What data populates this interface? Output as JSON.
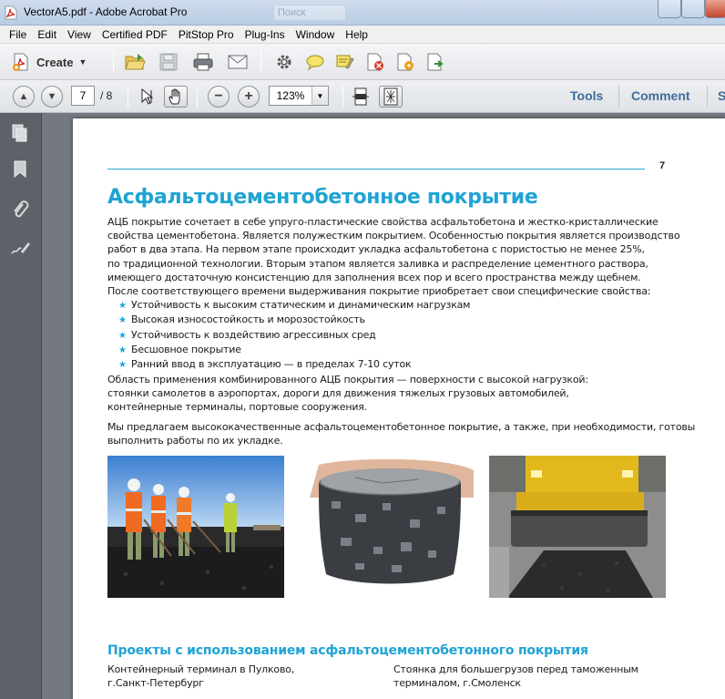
{
  "window": {
    "title": "VectorA5.pdf - Adobe Acrobat Pro",
    "search_placeholder": "Поиск"
  },
  "menu": [
    "File",
    "Edit",
    "View",
    "Certified PDF",
    "PitStop Pro",
    "Plug-Ins",
    "Window",
    "Help"
  ],
  "toolbar": {
    "create_label": "Create"
  },
  "navigation": {
    "current_page": "7",
    "total_pages": "/ 8",
    "zoom": "123%"
  },
  "panes": {
    "tools": "Tools",
    "comment": "Comment",
    "share": "S"
  },
  "document": {
    "page_number": "7",
    "title": "Асфальтоцементобетонное покрытие",
    "intro": [
      "АЦБ покрытие сочетает в себе упруго-пластические свойства асфальтобетона и жестко-кристаллические",
      "свойства цементобетона. Является полужестким покрытием. Особенностью покрытия является производство",
      "работ в два этапа. На первом этапе происходит укладка асфальтобетона с пористостью не менее 25%,",
      "по традиционной технологии. Вторым этапом является заливка и распределение цементного раствора,",
      "имеющего достаточную консистенцию для заполнения всех пор и всего пространства между щебнем.",
      "После соответствующего времени выдерживания покрытие приобретает свои специфические свойства:"
    ],
    "bullets": [
      "Устойчивость к высоким статическим и динамическим нагрузкам",
      "Высокая износостойкость и морозостойкость",
      "Устойчивость к воздействию агрессивных сред",
      "Бесшовное покрытие",
      "Ранний ввод в эксплуатацию — в пределах 7-10 суток"
    ],
    "application": [
      "Область применения комбинированного АЦБ покрытия — поверхности с высокой нагрузкой:",
      "стоянки самолетов в аэропортах, дороги для движения тяжелых грузовых автомобилей,",
      "контейнерные терминалы, портовые сооружения."
    ],
    "offer": [
      "Мы предлагаем высококачественные асфальтоцементобетонное покрытие, а также, при необходимости, готовы",
      "выполнить работы по их укладке."
    ],
    "projects_title": "Проекты с использованием асфальтоцементобетонного покрытия",
    "project_left": [
      "Контейнерный терминал в Пулково,",
      "г.Санкт-Петербург"
    ],
    "project_right": [
      "Стоянка для большегрузов перед таможенным",
      "терминалом, г.Смоленск"
    ]
  }
}
